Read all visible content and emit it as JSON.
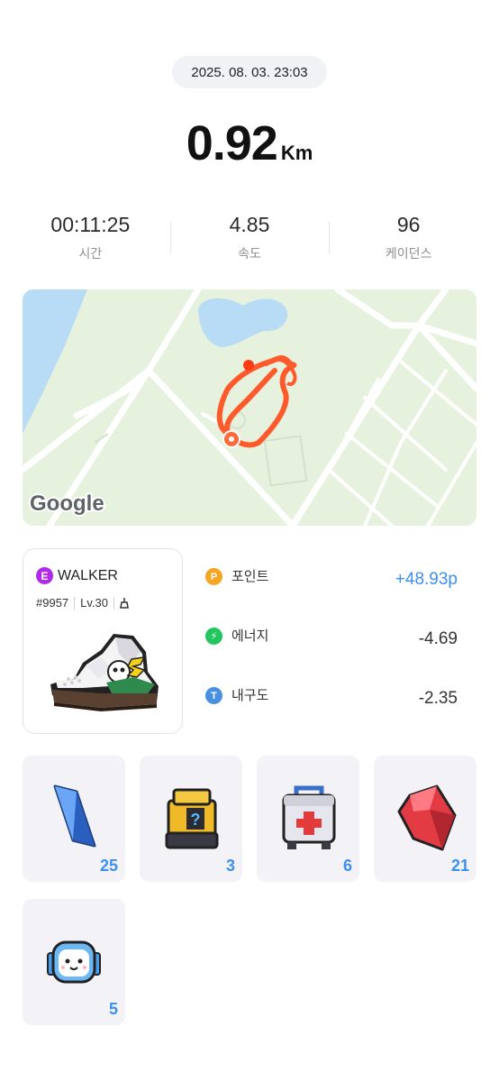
{
  "header": {
    "datetime": "2025. 08. 03. 23:03",
    "distance_value": "0.92",
    "distance_unit": "Km"
  },
  "stats": [
    {
      "value": "00:11:25",
      "label": "시간"
    },
    {
      "value": "4.85",
      "label": "속도"
    },
    {
      "value": "96",
      "label": "케이던스"
    }
  ],
  "map": {
    "attribution": "Google",
    "route_color": "#ff5a2c",
    "water_color": "#b8dcf6",
    "land_color": "#e6f2dd"
  },
  "walker": {
    "grade": "E",
    "name": "WALKER",
    "token_id": "#9957",
    "level": "Lv.30",
    "icon": "sneaker-icon"
  },
  "rewards": [
    {
      "icon_letter": "P",
      "icon": "point-icon",
      "color": "#f5a623",
      "label": "포인트",
      "value": "+48.93p"
    },
    {
      "icon_letter": "⚡",
      "icon": "energy-icon",
      "color": "#22c55e",
      "label": "에너지",
      "value": "-4.69"
    },
    {
      "icon_letter": "T",
      "icon": "durability-icon",
      "color": "#4a90e2",
      "label": "내구도",
      "value": "-2.35"
    }
  ],
  "items": [
    {
      "name": "blue-crystal",
      "count": "25"
    },
    {
      "name": "mystery-box",
      "count": "3"
    },
    {
      "name": "first-aid-kit",
      "count": "6"
    },
    {
      "name": "red-gem",
      "count": "21"
    },
    {
      "name": "robot-head",
      "count": "5"
    }
  ]
}
